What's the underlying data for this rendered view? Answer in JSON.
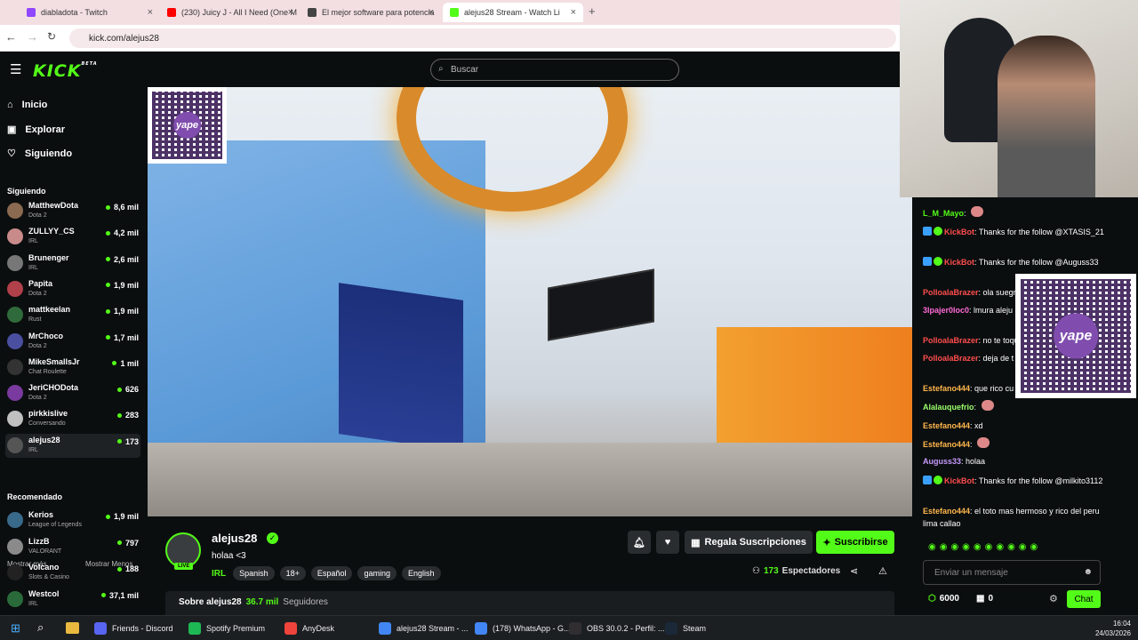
{
  "browser": {
    "tabs": [
      {
        "label": "diabladota - Twitch",
        "icon_color": "#9146ff"
      },
      {
        "label": "(230) Juicy J - All I Need (One M",
        "icon_color": "#ff0000"
      },
      {
        "label": "El mejor software para potencia",
        "icon_color": "#444444"
      },
      {
        "label": "alejus28 Stream - Watch Li",
        "icon_color": "#53fc18"
      }
    ],
    "url": "kick.com/alejus28"
  },
  "header": {
    "logo": "KICK",
    "logo_badge": "BETA",
    "search_placeholder": "Buscar"
  },
  "nav": [
    {
      "label": "Inicio",
      "icon": "home-icon"
    },
    {
      "label": "Explorar",
      "icon": "explore-icon"
    },
    {
      "label": "Siguiendo",
      "icon": "heart-icon"
    }
  ],
  "following": {
    "title": "Siguiendo",
    "channels": [
      {
        "name": "MatthewDota",
        "category": "Dota 2",
        "viewers": "8,6 mil",
        "color": "#8a6a50"
      },
      {
        "name": "ZULLYY_CS",
        "category": "IRL",
        "viewers": "4,2 mil",
        "color": "#c98a8a"
      },
      {
        "name": "Brunenger",
        "category": "IRL",
        "viewers": "2,6 mil",
        "color": "#777777"
      },
      {
        "name": "Papita",
        "category": "Dota 2",
        "viewers": "1,9 mil",
        "color": "#b0404a"
      },
      {
        "name": "mattkeelan",
        "category": "Rust",
        "viewers": "1,9 mil",
        "color": "#2f6b3a"
      },
      {
        "name": "MrChoco",
        "category": "Dota 2",
        "viewers": "1,7 mil",
        "color": "#4a4fa0"
      },
      {
        "name": "MikeSmallsJr",
        "category": "Chat Roulette",
        "viewers": "1 mil",
        "color": "#333333"
      },
      {
        "name": "JeriCHODota",
        "category": "Dota 2",
        "viewers": "626",
        "color": "#7a3aa0"
      },
      {
        "name": "pirkkislive",
        "category": "Conversando",
        "viewers": "283",
        "color": "#c0c0c0"
      },
      {
        "name": "alejus28",
        "category": "IRL",
        "viewers": "173",
        "color": "#555555"
      }
    ],
    "show_more": "Mostrar más",
    "show_less": "Mostrar Menos"
  },
  "recommended": {
    "title": "Recomendado",
    "channels": [
      {
        "name": "Kerios",
        "category": "League of Legends",
        "viewers": "1,9 mil",
        "color": "#3a6a8a"
      },
      {
        "name": "LizzB",
        "category": "VALORANT",
        "viewers": "797",
        "color": "#8a8a8a"
      },
      {
        "name": "Volcano",
        "category": "Slots & Casino",
        "viewers": "188",
        "color": "#222222"
      },
      {
        "name": "Westcol",
        "category": "IRL",
        "viewers": "37,1 mil",
        "color": "#2a6a3a"
      }
    ]
  },
  "qr_brand": "yape",
  "stream": {
    "channel": "alejus28",
    "title": "holaa <3",
    "category": "IRL",
    "live_badge": "LIVE",
    "tags": [
      "Spanish",
      "18+",
      "Español",
      "gaming",
      "English"
    ],
    "gift_label": "Regala Suscripciones",
    "subscribe_label": "Suscribirse",
    "viewers": "173",
    "viewers_label": "Espectadores",
    "about_label": "Sobre alejus28",
    "followers": "36.7 mil",
    "followers_label": "Seguidores"
  },
  "chat": {
    "messages": [
      {
        "user": "L_M_Mayo",
        "text": "",
        "color": "#53fc18"
      },
      {
        "user": "KickBot",
        "text": "Thanks for the follow @XTASIS_21",
        "color": "#ff4d4d"
      },
      {
        "user": "KickBot",
        "text": "Thanks for the follow @Auguss33",
        "color": "#ff4d4d"
      },
      {
        "user": "PolloalaBrazer",
        "text": "ola suegr",
        "color": "#ff4d4d"
      },
      {
        "user": "3lpajer0loc0",
        "text": "lmura aleju puedo pedir una foto o tu",
        "color": "#ff6bd6"
      },
      {
        "user": "PolloalaBrazer",
        "text": "no te toqu",
        "color": "#ff4d4d"
      },
      {
        "user": "PolloalaBrazer",
        "text": "deja de t uñas",
        "color": "#ff4d4d"
      },
      {
        "user": "Estefano444",
        "text": "que rico cu",
        "color": "#ffb74d"
      },
      {
        "user": "Alalauquefrio",
        "text": "",
        "color": "#9aff6b"
      },
      {
        "user": "Estefano444",
        "text": "xd",
        "color": "#ffb74d"
      },
      {
        "user": "Estefano444",
        "text": "",
        "color": "#ffb74d"
      },
      {
        "user": "Auguss33",
        "text": "holaa",
        "color": "#c79bff"
      },
      {
        "user": "KickBot",
        "text": "Thanks for the follow @milkito3112",
        "color": "#ff4d4d"
      },
      {
        "user": "Estefano444",
        "text": "el toto mas hermoso y rico del peru lima callao",
        "color": "#ffb74d"
      }
    ],
    "input_placeholder": "Enviar un mensaje",
    "points": "6000",
    "gifts": "0",
    "send_label": "Chat"
  },
  "taskbar": {
    "apps": [
      {
        "label": "Friends - Discord",
        "color": "#5865f2"
      },
      {
        "label": "Spotify Premium",
        "color": "#1db954"
      },
      {
        "label": "AnyDesk",
        "color": "#ef443b"
      },
      {
        "label": "alejus28 Stream - ...",
        "color": "#4285f4"
      },
      {
        "label": "(178) WhatsApp - G...",
        "color": "#4285f4"
      },
      {
        "label": "OBS 30.0.2 - Perfil: ...",
        "color": "#302e31"
      },
      {
        "label": "Steam",
        "color": "#1b2838"
      }
    ],
    "time": "16:04",
    "date": "24/03/2026"
  }
}
